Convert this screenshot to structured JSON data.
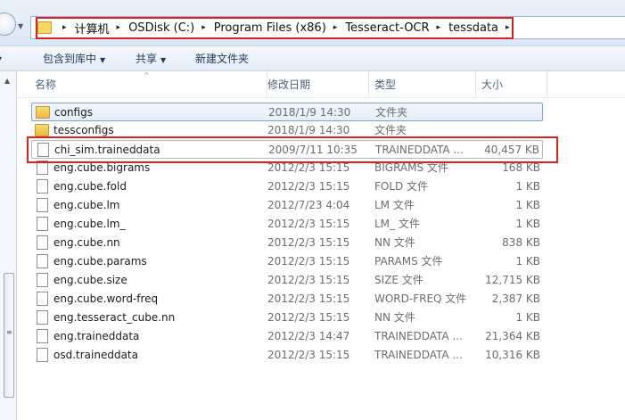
{
  "address": {
    "crumbs": [
      "计算机",
      "OSDisk (C:)",
      "Program Files (x86)",
      "Tesseract-OCR",
      "tessdata"
    ],
    "separator": "▸"
  },
  "toolbar": {
    "cut_left_arrow": "▾",
    "include_in_library": "包含到库中",
    "share": "共享",
    "new_folder": "新建文件夹",
    "dropdown_glyph": "▼"
  },
  "columns": {
    "name": "名称",
    "modified": "修改日期",
    "type": "类型",
    "size": "大小"
  },
  "files": [
    {
      "name": "configs",
      "date": "2018/1/9 14:30",
      "type": "文件夹",
      "size": "",
      "kind": "folder"
    },
    {
      "name": "tessconfigs",
      "date": "2018/1/9 14:30",
      "type": "文件夹",
      "size": "",
      "kind": "folder"
    },
    {
      "name": "chi_sim.traineddata",
      "date": "2009/7/11 10:35",
      "type": "TRAINEDDATA ...",
      "size": "40,457 KB",
      "kind": "file"
    },
    {
      "name": "eng.cube.bigrams",
      "date": "2012/2/3 15:15",
      "type": "BIGRAMS 文件",
      "size": "168 KB",
      "kind": "file"
    },
    {
      "name": "eng.cube.fold",
      "date": "2012/2/3 15:15",
      "type": "FOLD 文件",
      "size": "1 KB",
      "kind": "file"
    },
    {
      "name": "eng.cube.lm",
      "date": "2012/7/23 4:04",
      "type": "LM 文件",
      "size": "1 KB",
      "kind": "file"
    },
    {
      "name": "eng.cube.lm_",
      "date": "2012/2/3 15:15",
      "type": "LM_ 文件",
      "size": "1 KB",
      "kind": "file"
    },
    {
      "name": "eng.cube.nn",
      "date": "2012/2/3 15:15",
      "type": "NN 文件",
      "size": "838 KB",
      "kind": "file"
    },
    {
      "name": "eng.cube.params",
      "date": "2012/2/3 15:15",
      "type": "PARAMS 文件",
      "size": "1 KB",
      "kind": "file"
    },
    {
      "name": "eng.cube.size",
      "date": "2012/2/3 15:15",
      "type": "SIZE 文件",
      "size": "12,715 KB",
      "kind": "file"
    },
    {
      "name": "eng.cube.word-freq",
      "date": "2012/2/3 15:15",
      "type": "WORD-FREQ 文件",
      "size": "2,387 KB",
      "kind": "file"
    },
    {
      "name": "eng.tesseract_cube.nn",
      "date": "2012/2/3 15:15",
      "type": "NN 文件",
      "size": "1 KB",
      "kind": "file"
    },
    {
      "name": "eng.traineddata",
      "date": "2012/2/3 14:47",
      "type": "TRAINEDDATA ...",
      "size": "21,364 KB",
      "kind": "file"
    },
    {
      "name": "osd.traineddata",
      "date": "2012/2/3 15:15",
      "type": "TRAINEDDATA ...",
      "size": "10,316 KB",
      "kind": "file"
    }
  ],
  "colors": {
    "annotation_red": "#e02020",
    "selection_border": "#7da2ce"
  }
}
